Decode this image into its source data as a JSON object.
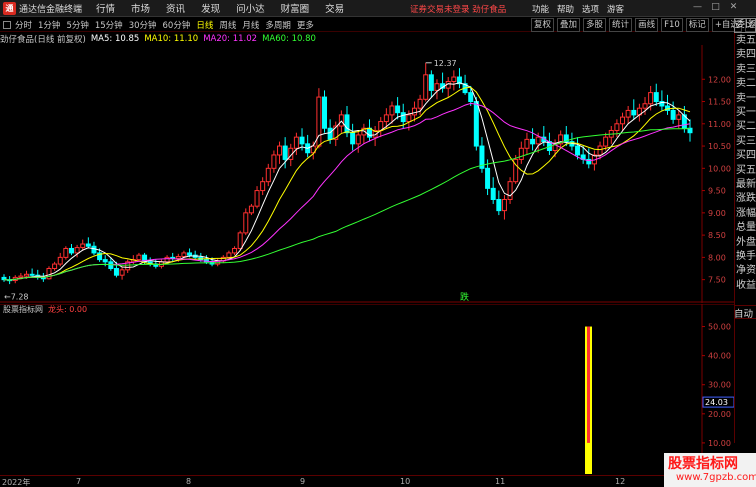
{
  "titlebar": {
    "logo": "通",
    "app_name": "通达信金融终端",
    "menus": [
      "行情",
      "市场",
      "资讯",
      "发现",
      "问小达",
      "财富圈",
      "交易"
    ],
    "notice": "证券交易未登录  劲仔食品",
    "right_menus": [
      "功能",
      "帮助",
      "选项",
      "游客"
    ],
    "win_buttons": [
      "—",
      "□",
      "✕"
    ]
  },
  "toolbar": {
    "periods": [
      "分时",
      "1分钟",
      "5分钟",
      "15分钟",
      "30分钟",
      "60分钟",
      "日线",
      "周线",
      "月线",
      "多周期",
      "更多"
    ],
    "active": "日线",
    "right_tools": [
      "复权",
      "叠加",
      "多股",
      "统计",
      "画线",
      "F10",
      "标记",
      "+自选",
      "返回"
    ]
  },
  "ma_line": {
    "name": "劲仔食品(日线 前复权)",
    "items": [
      {
        "label": "MA5: 10.85",
        "color": "#ffffff"
      },
      {
        "label": "MA10: 11.10",
        "color": "#ffff00"
      },
      {
        "label": "MA20: 11.02",
        "color": "#ff33ff"
      },
      {
        "label": "MA60: 10.80",
        "color": "#33ff33"
      }
    ]
  },
  "price_axis": {
    "labels": [
      "12.00",
      "11.50",
      "11.00",
      "10.50",
      "10.00",
      "9.50",
      "9.00",
      "8.50",
      "8.00",
      "7.50"
    ]
  },
  "annotations": {
    "high": "12.37",
    "low": "7.28",
    "down_marker": "跌"
  },
  "sidepanel": {
    "top": "委比",
    "labels": [
      "卖五",
      "卖四",
      "卖三",
      "卖二",
      "卖一",
      "买一",
      "买二",
      "买三",
      "买四",
      "买五",
      "最新",
      "涨跌",
      "涨幅",
      "总量",
      "外盘",
      "换手",
      "净资",
      "收益"
    ],
    "auto": "自动"
  },
  "sub_chart": {
    "name": "股票指标网",
    "indicator": "龙头: 0.00",
    "axis_labels": [
      "50.00",
      "40.00",
      "30.00",
      "20.00",
      "10.00"
    ],
    "marker_value": "24.03"
  },
  "date_axis": {
    "labels": [
      "2022年",
      "7",
      "8",
      "9",
      "10",
      "11",
      "12"
    ]
  },
  "watermark": {
    "line1": "股票指标网",
    "line2": "www.7gpzb.com"
  },
  "chart_data": {
    "type": "candlestick",
    "y_range": [
      7.2,
      12.5
    ],
    "ohlc": [
      [
        7.55,
        7.62,
        7.45,
        7.5
      ],
      [
        7.5,
        7.58,
        7.4,
        7.48
      ],
      [
        7.48,
        7.6,
        7.42,
        7.55
      ],
      [
        7.55,
        7.65,
        7.5,
        7.58
      ],
      [
        7.58,
        7.7,
        7.52,
        7.62
      ],
      [
        7.62,
        7.75,
        7.55,
        7.6
      ],
      [
        7.6,
        7.72,
        7.5,
        7.55
      ],
      [
        7.55,
        7.65,
        7.45,
        7.52
      ],
      [
        7.52,
        7.8,
        7.5,
        7.75
      ],
      [
        7.75,
        7.9,
        7.7,
        7.85
      ],
      [
        7.85,
        8.1,
        7.8,
        8.0
      ],
      [
        8.0,
        8.25,
        7.95,
        8.2
      ],
      [
        8.2,
        8.3,
        8.05,
        8.1
      ],
      [
        8.1,
        8.28,
        8.0,
        8.22
      ],
      [
        8.22,
        8.4,
        8.15,
        8.3
      ],
      [
        8.3,
        8.45,
        8.2,
        8.25
      ],
      [
        8.25,
        8.35,
        8.05,
        8.1
      ],
      [
        8.1,
        8.2,
        7.9,
        7.95
      ],
      [
        7.95,
        8.05,
        7.8,
        7.9
      ],
      [
        7.9,
        8.0,
        7.7,
        7.75
      ],
      [
        7.75,
        7.9,
        7.55,
        7.6
      ],
      [
        7.6,
        7.8,
        7.5,
        7.72
      ],
      [
        7.72,
        7.95,
        7.65,
        7.9
      ],
      [
        7.9,
        8.05,
        7.85,
        7.95
      ],
      [
        7.95,
        8.1,
        7.9,
        8.05
      ],
      [
        8.05,
        8.1,
        7.85,
        7.9
      ],
      [
        7.9,
        8.0,
        7.8,
        7.85
      ],
      [
        7.85,
        7.95,
        7.75,
        7.8
      ],
      [
        7.8,
        7.95,
        7.75,
        7.9
      ],
      [
        7.9,
        8.05,
        7.85,
        8.0
      ],
      [
        8.0,
        8.1,
        7.92,
        7.98
      ],
      [
        7.98,
        8.08,
        7.9,
        8.02
      ],
      [
        8.02,
        8.15,
        7.98,
        8.1
      ],
      [
        8.1,
        8.2,
        8.0,
        8.05
      ],
      [
        8.05,
        8.15,
        7.95,
        8.0
      ],
      [
        8.0,
        8.1,
        7.9,
        7.95
      ],
      [
        7.95,
        8.05,
        7.85,
        7.9
      ],
      [
        7.9,
        8.0,
        7.8,
        7.85
      ],
      [
        7.85,
        7.98,
        7.8,
        7.92
      ],
      [
        7.92,
        8.05,
        7.88,
        8.0
      ],
      [
        8.0,
        8.15,
        7.95,
        8.1
      ],
      [
        8.1,
        8.25,
        8.05,
        8.2
      ],
      [
        8.2,
        8.6,
        8.15,
        8.55
      ],
      [
        8.55,
        9.1,
        8.5,
        9.0
      ],
      [
        9.0,
        9.2,
        8.95,
        9.15
      ],
      [
        9.15,
        9.6,
        9.1,
        9.5
      ],
      [
        9.5,
        9.8,
        9.4,
        9.7
      ],
      [
        9.7,
        10.1,
        9.6,
        10.0
      ],
      [
        10.0,
        10.4,
        9.9,
        10.3
      ],
      [
        10.3,
        10.6,
        10.1,
        10.5
      ],
      [
        10.5,
        10.7,
        10.0,
        10.2
      ],
      [
        10.2,
        10.55,
        10.05,
        10.45
      ],
      [
        10.45,
        10.8,
        10.3,
        10.7
      ],
      [
        10.7,
        10.9,
        10.4,
        10.55
      ],
      [
        10.55,
        10.75,
        10.25,
        10.35
      ],
      [
        10.35,
        10.6,
        10.2,
        10.5
      ],
      [
        10.5,
        11.8,
        10.45,
        11.6
      ],
      [
        11.6,
        11.75,
        10.8,
        10.9
      ],
      [
        10.9,
        11.1,
        10.55,
        10.65
      ],
      [
        10.65,
        11.05,
        10.5,
        10.95
      ],
      [
        10.95,
        11.3,
        10.8,
        11.2
      ],
      [
        11.2,
        11.4,
        10.7,
        10.8
      ],
      [
        10.8,
        11.0,
        10.4,
        10.55
      ],
      [
        10.55,
        10.85,
        10.35,
        10.75
      ],
      [
        10.75,
        11.0,
        10.55,
        10.9
      ],
      [
        10.9,
        11.1,
        10.6,
        10.7
      ],
      [
        10.7,
        10.95,
        10.5,
        10.85
      ],
      [
        10.85,
        11.15,
        10.7,
        11.05
      ],
      [
        11.05,
        11.35,
        10.9,
        11.2
      ],
      [
        11.2,
        11.5,
        11.0,
        11.4
      ],
      [
        11.4,
        11.6,
        11.1,
        11.25
      ],
      [
        11.25,
        11.45,
        10.9,
        11.05
      ],
      [
        11.05,
        11.3,
        10.85,
        11.2
      ],
      [
        11.2,
        11.5,
        11.05,
        11.35
      ],
      [
        11.35,
        11.65,
        11.2,
        11.55
      ],
      [
        11.55,
        12.37,
        11.5,
        12.1
      ],
      [
        12.1,
        12.2,
        11.6,
        11.75
      ],
      [
        11.75,
        12.0,
        11.55,
        11.9
      ],
      [
        11.9,
        12.15,
        11.7,
        11.8
      ],
      [
        11.8,
        12.05,
        11.6,
        11.95
      ],
      [
        11.95,
        12.2,
        11.75,
        12.05
      ],
      [
        12.05,
        12.25,
        11.8,
        11.9
      ],
      [
        11.9,
        12.1,
        11.65,
        11.7
      ],
      [
        11.7,
        11.85,
        11.4,
        11.5
      ],
      [
        11.5,
        11.6,
        10.4,
        10.5
      ],
      [
        10.5,
        10.7,
        9.9,
        10.0
      ],
      [
        10.0,
        10.2,
        9.4,
        9.55
      ],
      [
        9.55,
        9.8,
        9.2,
        9.3
      ],
      [
        9.3,
        9.5,
        8.95,
        9.05
      ],
      [
        9.05,
        9.4,
        8.85,
        9.3
      ],
      [
        9.3,
        9.8,
        9.2,
        9.7
      ],
      [
        9.7,
        10.3,
        9.65,
        10.2
      ],
      [
        10.2,
        10.6,
        10.1,
        10.45
      ],
      [
        10.45,
        10.8,
        10.3,
        10.65
      ],
      [
        10.65,
        10.9,
        10.4,
        10.55
      ],
      [
        10.55,
        10.8,
        10.35,
        10.7
      ],
      [
        10.7,
        10.95,
        10.5,
        10.6
      ],
      [
        10.6,
        10.8,
        10.3,
        10.4
      ],
      [
        10.4,
        10.65,
        10.25,
        10.55
      ],
      [
        10.55,
        10.85,
        10.45,
        10.75
      ],
      [
        10.75,
        10.95,
        10.5,
        10.6
      ],
      [
        10.6,
        10.8,
        10.4,
        10.5
      ],
      [
        10.5,
        10.7,
        10.2,
        10.3
      ],
      [
        10.3,
        10.5,
        10.1,
        10.2
      ],
      [
        10.2,
        10.45,
        10.0,
        10.1
      ],
      [
        10.1,
        10.4,
        9.95,
        10.3
      ],
      [
        10.3,
        10.6,
        10.2,
        10.5
      ],
      [
        10.5,
        10.8,
        10.4,
        10.7
      ],
      [
        10.7,
        10.95,
        10.55,
        10.85
      ],
      [
        10.85,
        11.1,
        10.7,
        11.0
      ],
      [
        11.0,
        11.25,
        10.85,
        11.15
      ],
      [
        11.15,
        11.4,
        11.0,
        11.3
      ],
      [
        11.3,
        11.55,
        11.1,
        11.2
      ],
      [
        11.2,
        11.45,
        11.05,
        11.35
      ],
      [
        11.35,
        11.6,
        11.2,
        11.45
      ],
      [
        11.45,
        11.85,
        11.3,
        11.7
      ],
      [
        11.7,
        11.9,
        11.4,
        11.5
      ],
      [
        11.5,
        11.75,
        11.3,
        11.4
      ],
      [
        11.4,
        11.65,
        11.2,
        11.3
      ],
      [
        11.3,
        11.5,
        11.0,
        11.1
      ],
      [
        11.1,
        11.3,
        10.9,
        11.2
      ],
      [
        11.2,
        11.4,
        10.8,
        10.9
      ],
      [
        10.9,
        11.1,
        10.6,
        10.8
      ]
    ],
    "ma5_color": "#ffffff",
    "ma10_color": "#ffff00",
    "ma20_color": "#ff33ff",
    "ma60_color": "#33ff33",
    "sub_bar": {
      "index": "late-oct",
      "value": 50,
      "secondary": 10
    }
  }
}
